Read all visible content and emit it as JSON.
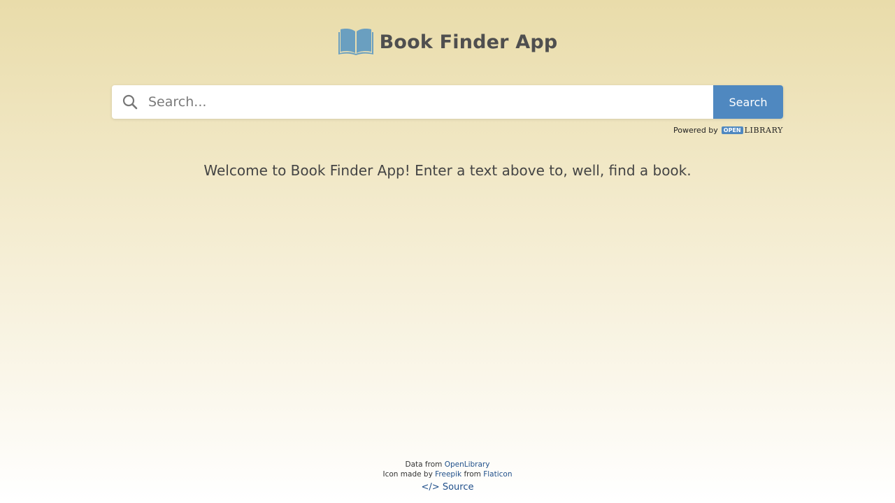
{
  "header": {
    "logo_icon": "open-book-icon",
    "title": "Book Finder App"
  },
  "search": {
    "icon": "search-icon",
    "placeholder": "Search...",
    "value": "",
    "button_label": "Search"
  },
  "powered_by": {
    "label": "Powered by",
    "logo_open": "OPEN",
    "logo_library": "LIBRARY"
  },
  "welcome_text": "Welcome to Book Finder App! Enter a text above to, well, find a book.",
  "footer": {
    "data_from_label": "Data from",
    "data_from_link": "OpenLibrary",
    "icon_made_by_label": "Icon made by",
    "icon_author_link": "Freepik",
    "from_label": "from",
    "icon_source_link": "Flaticon",
    "source_label": "</> Source"
  },
  "colors": {
    "accent": "#4f88c0",
    "logo": "#6a9fc0",
    "link": "#1f4f8a",
    "title": "#4f4f4f"
  }
}
